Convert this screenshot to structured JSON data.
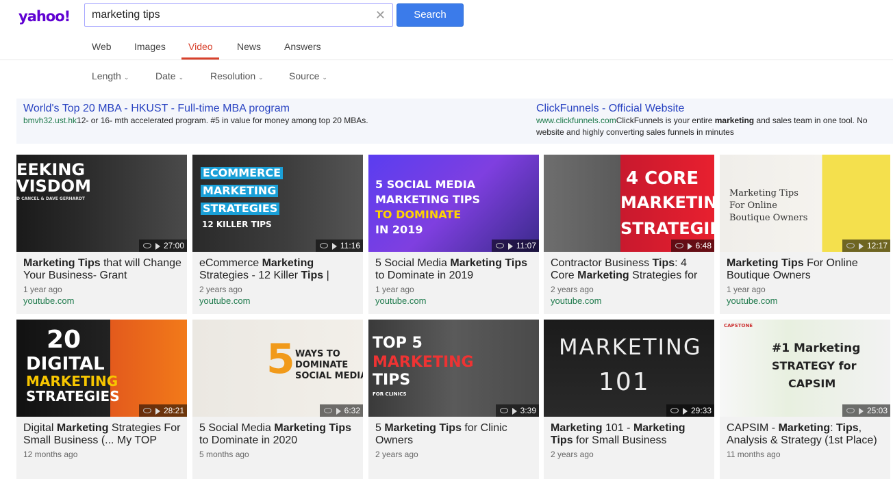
{
  "logo": "yahoo!",
  "search": {
    "value": "marketing tips",
    "button": "Search"
  },
  "tabs": [
    {
      "label": "Web",
      "active": false
    },
    {
      "label": "Images",
      "active": false
    },
    {
      "label": "Video",
      "active": true
    },
    {
      "label": "News",
      "active": false
    },
    {
      "label": "Answers",
      "active": false
    }
  ],
  "filters": [
    "Length",
    "Date",
    "Resolution",
    "Source"
  ],
  "ads": [
    {
      "title": "World's Top 20 MBA - HKUST - Full-time MBA program",
      "url": "bmvh32.ust.hk",
      "text": "12- or 16- mth accelerated program. #5 in value for money among top 20 MBAs."
    },
    {
      "title": "ClickFunnels - Official Website",
      "url": "www.clickfunnels.com",
      "text_pre": "ClickFunnels is your entire ",
      "text_bold": "marketing",
      "text_post": " and sales team in one tool. No",
      "text2": "website and highly converting sales funnels in minutes"
    }
  ],
  "videos": [
    {
      "title_html": "<b>Marketing Tips</b> that will Change Your Business- Grant",
      "age": "1 year ago",
      "site": "youtube.com",
      "duration": "27:00",
      "thumb_text": [
        "EEKING",
        "VISDOM",
        "D CANCEL & DAVE GERHARDT"
      ]
    },
    {
      "title_html": "eCommerce <b>Marketing</b> Strategies - 12 Killer <b>Tips</b> |",
      "age": "2 years ago",
      "site": "youtube.com",
      "duration": "11:16",
      "thumb_text": [
        "ECOMMERCE",
        "MARKETING",
        "STRATEGIES",
        "12 KILLER TIPS"
      ]
    },
    {
      "title_html": "5 Social Media <b>Marketing Tips</b> to Dominate in 2019",
      "age": "1 year ago",
      "site": "youtube.com",
      "duration": "11:07",
      "thumb_text": [
        "5 SOCIAL MEDIA",
        "MARKETING TIPS",
        "TO DOMINATE",
        "IN 2019"
      ]
    },
    {
      "title_html": "Contractor Business <b>Tips</b>: 4 Core <b>Marketing</b> Strategies for",
      "age": "2 years ago",
      "site": "youtube.com",
      "duration": "6:48",
      "thumb_text": [
        "4 CORE",
        "MARKETING",
        "STRATEGIES"
      ]
    },
    {
      "title_html": "<b>Marketing Tips</b> For Online Boutique Owners",
      "age": "1 year ago",
      "site": "youtube.com",
      "duration": "12:17",
      "thumb_text": [
        "Marketing Tips",
        "For Online",
        "Boutique Owners"
      ]
    },
    {
      "title_html": "Digital <b>Marketing</b> Strategies For Small Business (... My TOP",
      "age": "12 months ago",
      "site": "",
      "duration": "28:21",
      "thumb_text": [
        "20",
        "DIGITAL",
        "MARKETING",
        "STRATEGIES"
      ]
    },
    {
      "title_html": "5 Social Media <b>Marketing Tips</b> to Dominate in 2020",
      "age": "5 months ago",
      "site": "",
      "duration": "6:32",
      "thumb_text": [
        "5",
        "WAYS TO",
        "DOMINATE",
        "SOCIAL MEDIA"
      ]
    },
    {
      "title_html": "5 <b>Marketing Tips</b> for Clinic Owners",
      "age": "2 years ago",
      "site": "",
      "duration": "3:39",
      "thumb_text": [
        "TOP 5",
        "MARKETING",
        "TIPS",
        "FOR CLINICS"
      ]
    },
    {
      "title_html": "<b>Marketing</b> 101 - <b>Marketing Tips</b> for Small Business",
      "age": "2 years ago",
      "site": "",
      "duration": "29:33",
      "thumb_text": [
        "MARKETING",
        "101"
      ]
    },
    {
      "title_html": "CAPSIM - <b>Marketing</b>: <b>Tips</b>, Analysis &amp; Strategy (1st Place)",
      "age": "11 months ago",
      "site": "",
      "duration": "25:03",
      "thumb_text": [
        "#1 Marketing",
        "STRATEGY for",
        "CAPSIM",
        "CAPSTONE"
      ]
    }
  ],
  "colors": {
    "brand": "#6001d2",
    "accent": "#d8412c",
    "button": "#3b7bea",
    "link": "#2a44c2",
    "url": "#1e7a4c"
  }
}
